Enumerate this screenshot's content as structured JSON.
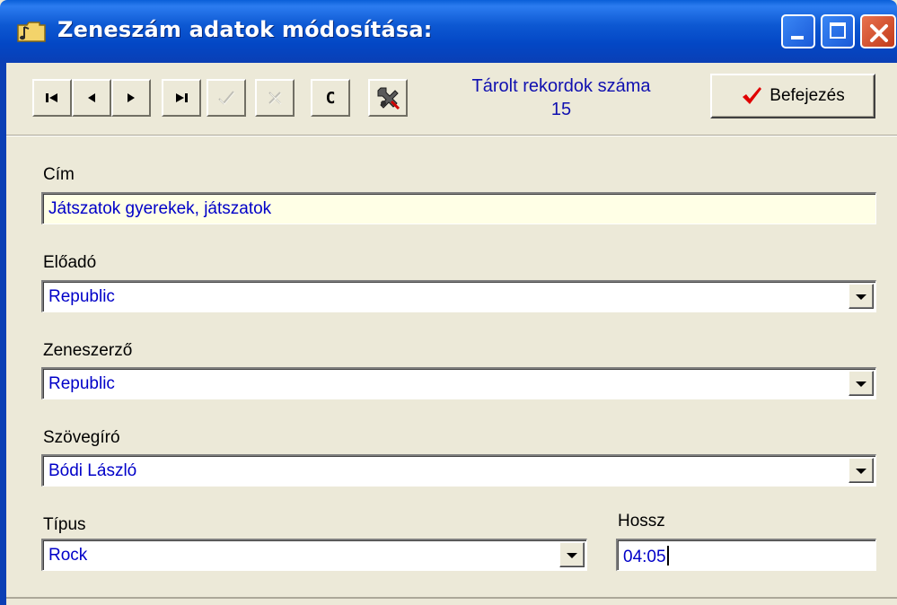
{
  "window": {
    "title": "Zeneszám adatok módosítása:",
    "title_icon": "music-folder-icon",
    "controls": [
      "minimize-icon",
      "maximize-icon",
      "close-icon"
    ]
  },
  "toolbar": {
    "nav_buttons": [
      {
        "name": "first-record-button",
        "icon": "first-icon",
        "enabled": true
      },
      {
        "name": "prev-record-button",
        "icon": "prev-icon",
        "enabled": true
      },
      {
        "name": "next-record-button",
        "icon": "next-icon",
        "enabled": true
      },
      {
        "name": "last-record-button",
        "icon": "last-icon",
        "enabled": true
      },
      {
        "name": "post-button",
        "icon": "check-icon",
        "enabled": false
      },
      {
        "name": "cancel-button",
        "icon": "cancel-icon",
        "enabled": false
      }
    ],
    "c_button_label": "C",
    "tools_icon": "tools-icon",
    "records_label": "Tárolt rekordok száma",
    "records_count": "15",
    "finish_label": "Befejezés",
    "finish_icon": "red-check-icon"
  },
  "form": {
    "cim": {
      "label": "Cím",
      "value": "Játszatok gyerekek, játszatok"
    },
    "eloado": {
      "label": "Előadó",
      "value": "Republic"
    },
    "zeneszerzo": {
      "label": "Zeneszerző",
      "value": "Republic"
    },
    "szovegiro": {
      "label": "Szövegíró",
      "value": "Bódi László"
    },
    "tipus": {
      "label": "Típus",
      "value": "Rock"
    },
    "hossz": {
      "label": "Hossz",
      "value": "04:05"
    }
  },
  "colors": {
    "titlebar": "#0347c5",
    "value_text": "#0000c8",
    "highlight_field": "#ffffe6",
    "close_button": "#c23b1a",
    "finish_check": "#e00000"
  }
}
